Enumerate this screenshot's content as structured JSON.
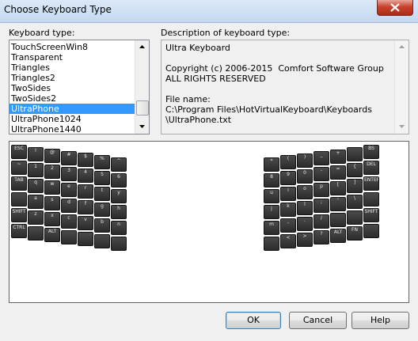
{
  "window": {
    "title": "Choose Keyboard Type"
  },
  "labels": {
    "keyboard_type": "Keyboard type:",
    "description": "Description of keyboard type:"
  },
  "keyboard_list": {
    "items": [
      "TouchScreenWin8",
      "Transparent",
      "Triangles",
      "Triangles2",
      "TwoSides",
      "TwoSides2",
      "UltraPhone",
      "UltraPhone1024",
      "UltraPhone1440"
    ],
    "selected": "UltraPhone"
  },
  "description_text": "Ultra Keyboard\n\nCopyright (c) 2006-2015  Comfort Software Group\nALL RIGHTS RESERVED\n\nFile name:\nC:\\Program Files\\HotVirtualKeyboard\\Keyboards\n\\UltraPhone.txt",
  "preview": {
    "left_keys": [
      [
        "ESC",
        "~",
        "TAB",
        "",
        "SHIFT",
        "CTRL"
      ],
      [
        "!",
        "1",
        "q",
        "a",
        "z",
        ""
      ],
      [
        "@",
        "2",
        "w",
        "s",
        "x",
        "ALT"
      ],
      [
        "#",
        "3",
        "e",
        "d",
        "c",
        ""
      ],
      [
        "$",
        "4",
        "r",
        "f",
        "v",
        ""
      ],
      [
        "%",
        "5",
        "t",
        "g",
        "b",
        ""
      ],
      [
        "^",
        "6",
        "y",
        "h",
        "n",
        ""
      ]
    ],
    "right_keys": [
      [
        "*",
        "8",
        "u",
        "j",
        "m",
        ""
      ],
      [
        "(",
        "9",
        "i",
        "k",
        ",",
        "<"
      ],
      [
        ")",
        "0",
        "o",
        "l",
        ".",
        ">"
      ],
      [
        "_",
        "-",
        "p",
        ";",
        "/",
        "?"
      ],
      [
        "+",
        "=",
        "[",
        "'",
        "",
        "ALT"
      ],
      [
        "",
        "{",
        "]",
        "\\",
        "",
        "FN"
      ],
      [
        "BS",
        "DEL",
        "ENTER",
        "",
        "SHIFT",
        ""
      ]
    ]
  },
  "buttons": {
    "ok": "OK",
    "cancel": "Cancel",
    "help": "Help"
  },
  "colors": {
    "selection": "#3399ff",
    "key_label_alt": "#3fb0ff",
    "close_button": "#c7432f"
  }
}
